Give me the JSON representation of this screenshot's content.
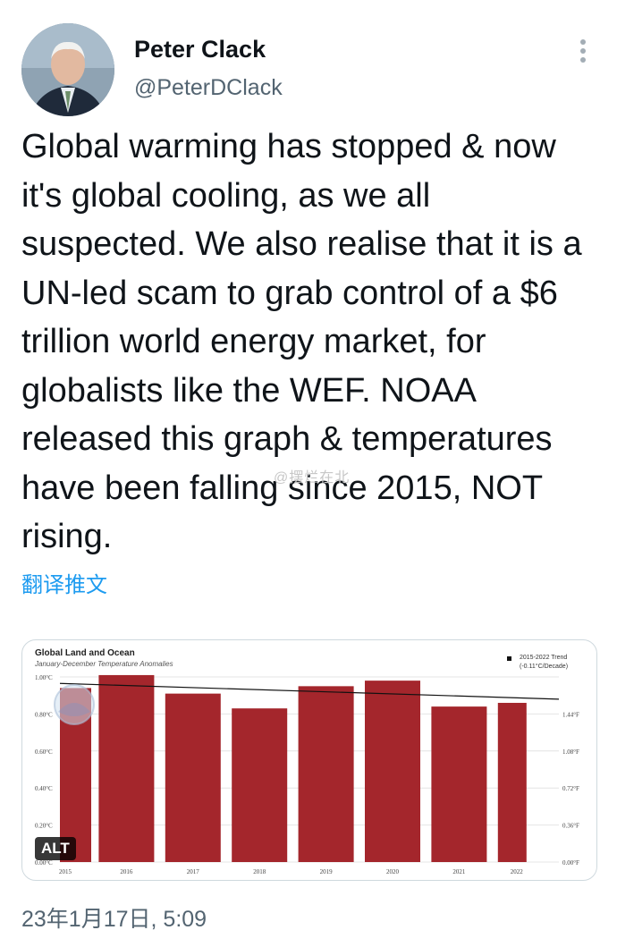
{
  "author": {
    "name": "Peter Clack",
    "handle": "@PeterDClack"
  },
  "tweet": {
    "text": "Global warming has stopped & now it's global cooling, as we all suspected. We also realise that it is a UN-led scam to grab control of a $6 trillion world energy market, for globalists like the WEF. NOAA released this graph & temperatures have been falling since 2015, NOT rising.",
    "translate_label": "翻译推文",
    "timestamp": "23年1月17日, 5:09",
    "watermark": "@摆烂在北"
  },
  "media": {
    "alt_label": "ALT"
  },
  "icons": {
    "more": "more-vertical-icon",
    "noaa_logo": "noaa-logo-icon"
  },
  "colors": {
    "bar": "#a4262c",
    "link": "#1d9bf0",
    "handle": "#536471"
  },
  "chart_data": {
    "type": "bar",
    "title": "Global Land and Ocean",
    "subtitle": "January-December Temperature Anomalies",
    "categories": [
      "2015",
      "2016",
      "2017",
      "2018",
      "2019",
      "2020",
      "2021",
      "2022"
    ],
    "values": [
      0.94,
      1.01,
      0.91,
      0.83,
      0.95,
      0.98,
      0.84,
      0.86
    ],
    "ylim": [
      0,
      1.0
    ],
    "y_ticks_left": [
      "0.00°C",
      "0.20°C",
      "0.40°C",
      "0.60°C",
      "0.80°C",
      "1.00°C"
    ],
    "y_ticks_right": [
      "0.00°F",
      "0.36°F",
      "0.72°F",
      "1.08°F",
      "1.44°F"
    ],
    "trend": {
      "label_line1": "2015-2022 Trend",
      "label_line2": "(-0.11°C/Decade)",
      "start": 0.965,
      "end": 0.88
    },
    "grid": true
  }
}
